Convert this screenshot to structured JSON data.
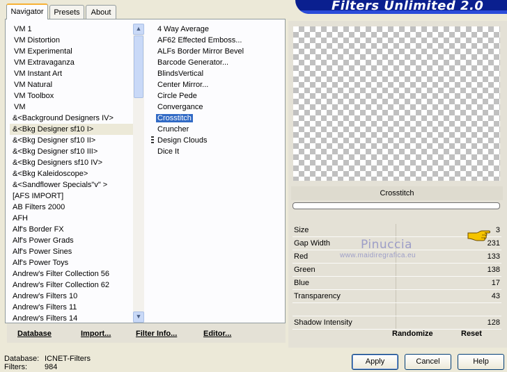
{
  "title": "Filters Unlimited 2.0",
  "tabs": [
    "Navigator",
    "Presets",
    "About"
  ],
  "categories": [
    "VM 1",
    "VM Distortion",
    "VM Experimental",
    "VM Extravaganza",
    "VM Instant Art",
    "VM Natural",
    "VM Toolbox",
    "VM",
    "&<Background Designers IV>",
    "&<Bkg Designer sf10 I>",
    "&<Bkg Designer sf10 II>",
    "&<Bkg Designer sf10 III>",
    "&<Bkg Designers sf10 IV>",
    "&<Bkg Kaleidoscope>",
    "&<Sandflower Specials\"v\" >",
    "[AFS IMPORT]",
    "AB Filters 2000",
    "AFH",
    "Alf's Border FX",
    "Alf's Power Grads",
    "Alf's Power Sines",
    "Alf's Power Toys",
    "Andrew's Filter Collection 56",
    "Andrew's Filter Collection 62",
    "Andrew's Filters 10",
    "Andrew's Filters 11",
    "Andrew's Filters 14"
  ],
  "selected_category": "&<Bkg Designer sf10 I>",
  "filters": [
    "4 Way Average",
    "AF62 Effected Emboss...",
    "ALFs Border Mirror Bevel",
    "Barcode Generator...",
    "BlindsVertical",
    "Center Mirror...",
    "Circle Pede",
    "Convergance",
    "Crosstitch",
    "Cruncher",
    "Design Clouds",
    "Dice It"
  ],
  "selected_filter": "Crosstitch",
  "left_buttons": {
    "database": "Database",
    "import": "Import...",
    "filter_info": "Filter Info...",
    "editor": "Editor..."
  },
  "filter_name": "Crosstitch",
  "params": [
    {
      "label": "Size",
      "value": "3"
    },
    {
      "label": "Gap Width",
      "value": "231"
    },
    {
      "label": "Red",
      "value": "133"
    },
    {
      "label": "Green",
      "value": "138"
    },
    {
      "label": "Blue",
      "value": "17"
    },
    {
      "label": "Transparency",
      "value": "43"
    },
    {
      "label": "",
      "value": ""
    },
    {
      "label": "Shadow Intensity",
      "value": "128"
    }
  ],
  "watermark": {
    "name": "Pinuccia",
    "url": "www.maidiregrafica.eu"
  },
  "right_buttons": {
    "randomize": "Randomize",
    "reset": "Reset"
  },
  "status": {
    "database_label": "Database:",
    "database_value": "ICNET-Filters",
    "filters_label": "Filters:",
    "filters_value": "984"
  },
  "bottom_buttons": {
    "apply": "Apply",
    "cancel": "Cancel",
    "help": "Help"
  },
  "colors": {
    "banner": "#0a1f8f",
    "selection": "#316ac5",
    "face": "#ece9d8"
  },
  "icons": {
    "hand": "pointing-hand-icon"
  }
}
